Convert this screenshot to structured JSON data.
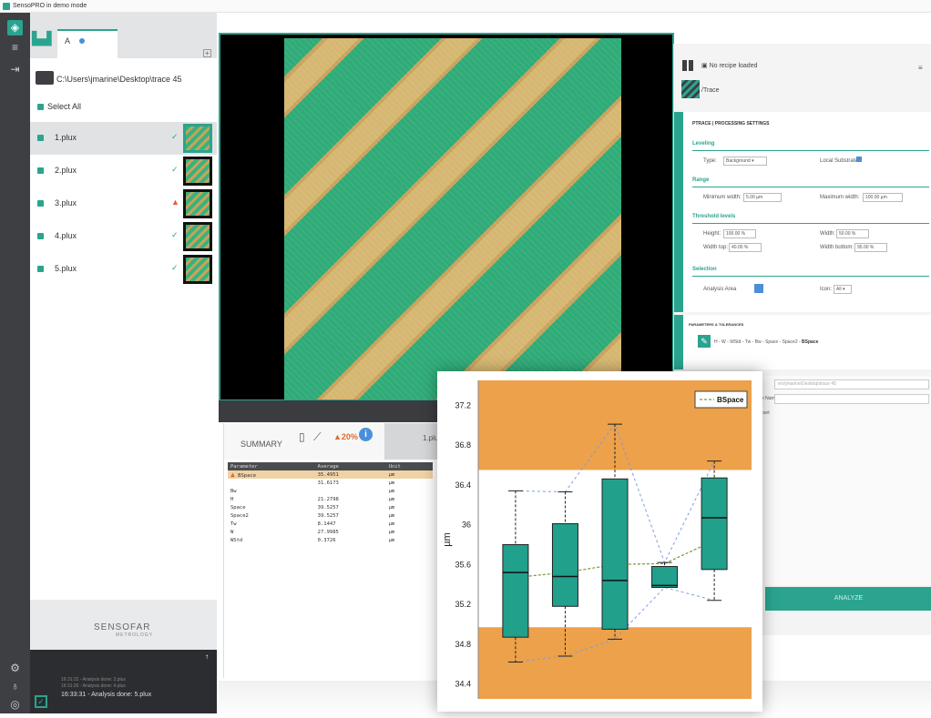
{
  "window": {
    "title": "SensoPRO in demo mode",
    "controls": "- □"
  },
  "left": {
    "tab_label": "A",
    "path": "C:\\Users\\jmarine\\Desktop\\trace 45",
    "select_all": "Select All",
    "files": [
      {
        "name": "1.plux",
        "status": "ok",
        "status_glyph": "✓",
        "selected": true
      },
      {
        "name": "2.plux",
        "status": "ok",
        "status_glyph": "✓",
        "selected": false
      },
      {
        "name": "3.plux",
        "status": "warn",
        "status_glyph": "▲",
        "selected": false
      },
      {
        "name": "4.plux",
        "status": "ok",
        "status_glyph": "✓",
        "selected": false
      },
      {
        "name": "5.plux",
        "status": "ok",
        "status_glyph": "✓",
        "selected": false
      }
    ],
    "logo": "SENSOFAR",
    "logo_sub": "METROLOGY",
    "log_lines": [
      "16:31:22 - Analysis done: 3.plux",
      "16:31:26 - Analysis done: 4.plux",
      "16:33:31 - Analysis done: 5.plux"
    ]
  },
  "summary": {
    "tab": "SUMMARY",
    "warn_percent": "20%",
    "file_tab": "1.plux",
    "columns": [
      "Parameter",
      "Average",
      "Unit"
    ],
    "rows": [
      {
        "param": "BSpace",
        "avg": "35.4951",
        "unit": "µm",
        "warn": true
      },
      {
        "param": "",
        "avg": "31.6173",
        "unit": "µm",
        "warn": false
      },
      {
        "param": "Bw",
        "avg": "",
        "unit": "µm",
        "warn": false
      },
      {
        "param": "H",
        "avg": "21.2798",
        "unit": "µm",
        "warn": false
      },
      {
        "param": "Space",
        "avg": "39.5257",
        "unit": "µm",
        "warn": false
      },
      {
        "param": "Space2",
        "avg": "39.5257",
        "unit": "µm",
        "warn": false
      },
      {
        "param": "Tw",
        "avg": "8.1447",
        "unit": "µm",
        "warn": false
      },
      {
        "param": "W",
        "avg": "27.9985",
        "unit": "µm",
        "warn": false
      },
      {
        "param": "WStd",
        "avg": "0.3726",
        "unit": "µm",
        "warn": false
      }
    ]
  },
  "right": {
    "recipe": "No recipe loaded",
    "trace_name": "/Trace",
    "settings_header": "PTRACE | PROCESSING SETTINGS",
    "leveling": "Leveling",
    "type_label": "Type:",
    "type_value": "Background",
    "local_substrate": "Local Substrate",
    "range": "Range",
    "min_width_label": "Minimum width:",
    "min_width_value": "5.00 µm",
    "max_width_label": "Maximum width:",
    "max_width_value": "100.00 µm",
    "threshold": "Threshold levels",
    "height_label": "Height:",
    "height_value": "100.00 %",
    "width_label": "Width:",
    "width_value": "50.00 %",
    "width_top_label": "Width top:",
    "width_top_value": "40.00 %",
    "width_bottom_label": "Width bottom:",
    "width_bottom_value": "95.00 %",
    "selection": "Selection",
    "analysis_area": "Analysis Area",
    "icon_label": "Icon:",
    "icon_value": "All",
    "params_header": "PARAMETERS & TOLERANCES",
    "params_list": "H - W - WStd - Tw - Bw - Space - Space2 - ",
    "params_bold": "BSpace",
    "output_path": "ers\\jmarine\\Desktop\\trace 45",
    "name_label": "e Name:",
    "report_label": "port",
    "analyze": "ANALYZE"
  },
  "chart_data": {
    "type": "box",
    "ylabel": "µm",
    "ylim": [
      34.25,
      37.45
    ],
    "yticks": [
      34.4,
      34.8,
      35.2,
      35.6,
      36,
      36.4,
      36.8,
      37.2
    ],
    "ytick_labels": [
      "34.4",
      "34.8",
      "35.2",
      "35.6",
      "36",
      "36.4",
      "36.8",
      "37.2"
    ],
    "tolerance_bands": [
      {
        "from": 36.55,
        "to": 37.45
      },
      {
        "from": 34.25,
        "to": 34.97
      }
    ],
    "legend": "BSpace",
    "legend_position": "top-right",
    "boxes": [
      {
        "min": 34.62,
        "q1": 34.87,
        "median": 35.52,
        "q3": 35.8,
        "max": 36.34,
        "mean": 35.47
      },
      {
        "min": 34.68,
        "q1": 35.18,
        "median": 35.48,
        "q3": 36.01,
        "max": 36.33,
        "mean": 35.52
      },
      {
        "min": 34.85,
        "q1": 34.95,
        "median": 35.44,
        "q3": 36.46,
        "max": 37.01,
        "mean": 35.6
      },
      {
        "min": 35.37,
        "q1": 35.37,
        "median": 35.39,
        "q3": 35.58,
        "max": 35.62,
        "mean": 35.61
      },
      {
        "min": 35.24,
        "q1": 35.55,
        "median": 36.07,
        "q3": 36.47,
        "max": 36.64,
        "mean": 35.84
      }
    ],
    "colors": {
      "box": "#21a08c",
      "band": "#eda14a",
      "mean_line": "#6c9e3a",
      "whisker_line": "#7a9ee0"
    }
  }
}
